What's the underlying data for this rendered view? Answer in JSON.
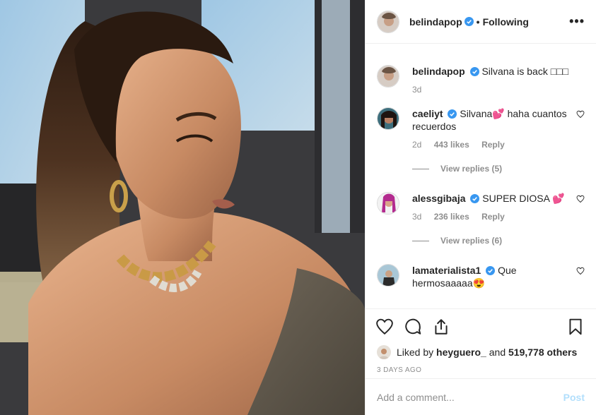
{
  "post": {
    "username": "belindapop",
    "follow_status": "Following",
    "separator": "•",
    "more_label": "•••"
  },
  "caption": {
    "username": "belindapop",
    "text": "Silvana is back □□□",
    "time": "3d"
  },
  "comments": [
    {
      "username": "caeliyt",
      "text": "Silvana💕 haha cuantos recuerdos",
      "time": "2d",
      "likes": "443 likes",
      "reply_label": "Reply",
      "view_replies": "View replies (5)"
    },
    {
      "username": "alessgibaja",
      "text": "SUPER DIOSA 💕",
      "time": "3d",
      "likes": "236 likes",
      "reply_label": "Reply",
      "view_replies": "View replies (6)"
    },
    {
      "username": "lamaterialista1",
      "text": "Que hermosaaaaa😍",
      "time": "",
      "likes": "",
      "reply_label": "",
      "view_replies": ""
    }
  ],
  "likes_line": {
    "prefix": "Liked by ",
    "user": "heyguero_",
    "middle": " and ",
    "count": "519,778 others"
  },
  "date": "3 DAYS AGO",
  "add_comment": {
    "placeholder": "Add a comment...",
    "post_label": "Post"
  },
  "colors": {
    "verified": "#3897f0",
    "muted": "#8e8e8e",
    "post_disabled": "#b2dffc"
  },
  "icons": [
    "verified-badge-icon",
    "more-options-icon",
    "heart-icon",
    "comment-icon",
    "share-icon",
    "bookmark-icon"
  ]
}
